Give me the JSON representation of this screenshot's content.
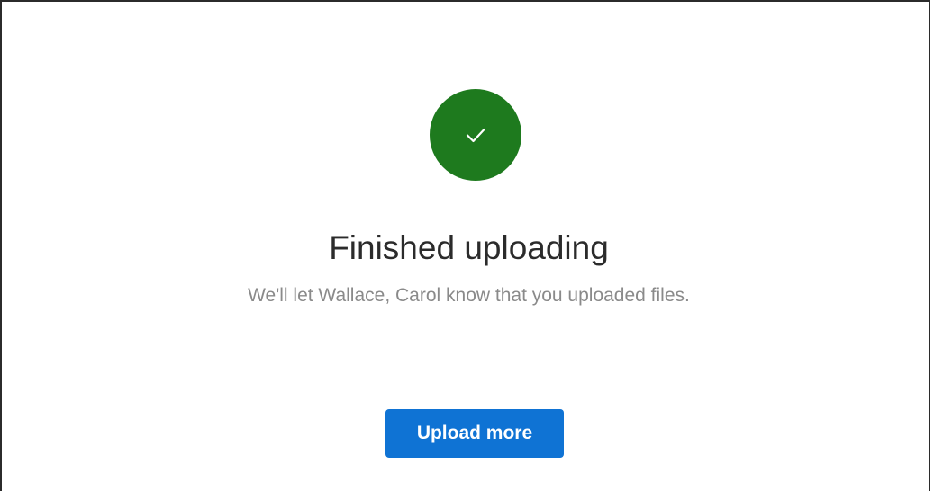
{
  "status": {
    "icon": "checkmark-icon",
    "color": "#1e7a1e"
  },
  "title": "Finished uploading",
  "message": "We'll let Wallace, Carol know that you uploaded files.",
  "actions": {
    "upload_more_label": "Upload more",
    "button_color": "#0f73d4"
  }
}
